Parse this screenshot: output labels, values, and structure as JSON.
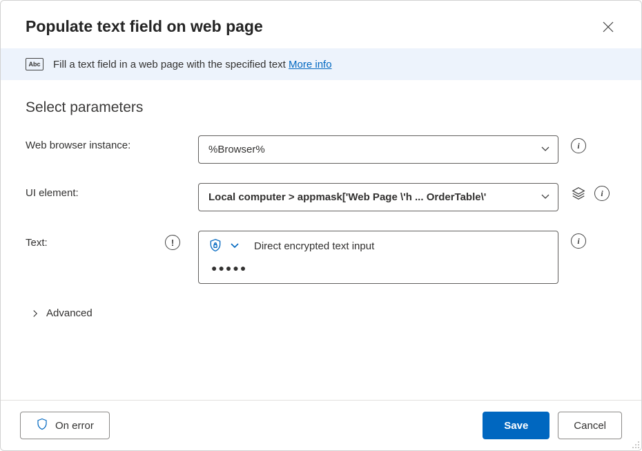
{
  "header": {
    "title": "Populate text field on web page"
  },
  "infoBar": {
    "text": "Fill a text field in a web page with the specified text ",
    "linkText": "More info"
  },
  "section": {
    "title": "Select parameters"
  },
  "params": {
    "browser": {
      "label": "Web browser instance:",
      "value": "%Browser%"
    },
    "uiElement": {
      "label": "UI element:",
      "value": "Local computer > appmask['Web Page \\'h ... OrderTable\\'"
    },
    "text": {
      "label": "Text:",
      "typeLabel": "Direct encrypted text input",
      "maskedValue": "●●●●●"
    }
  },
  "advanced": {
    "label": "Advanced"
  },
  "footer": {
    "onError": "On error",
    "save": "Save",
    "cancel": "Cancel"
  },
  "icons": {
    "abc": "Abc"
  }
}
